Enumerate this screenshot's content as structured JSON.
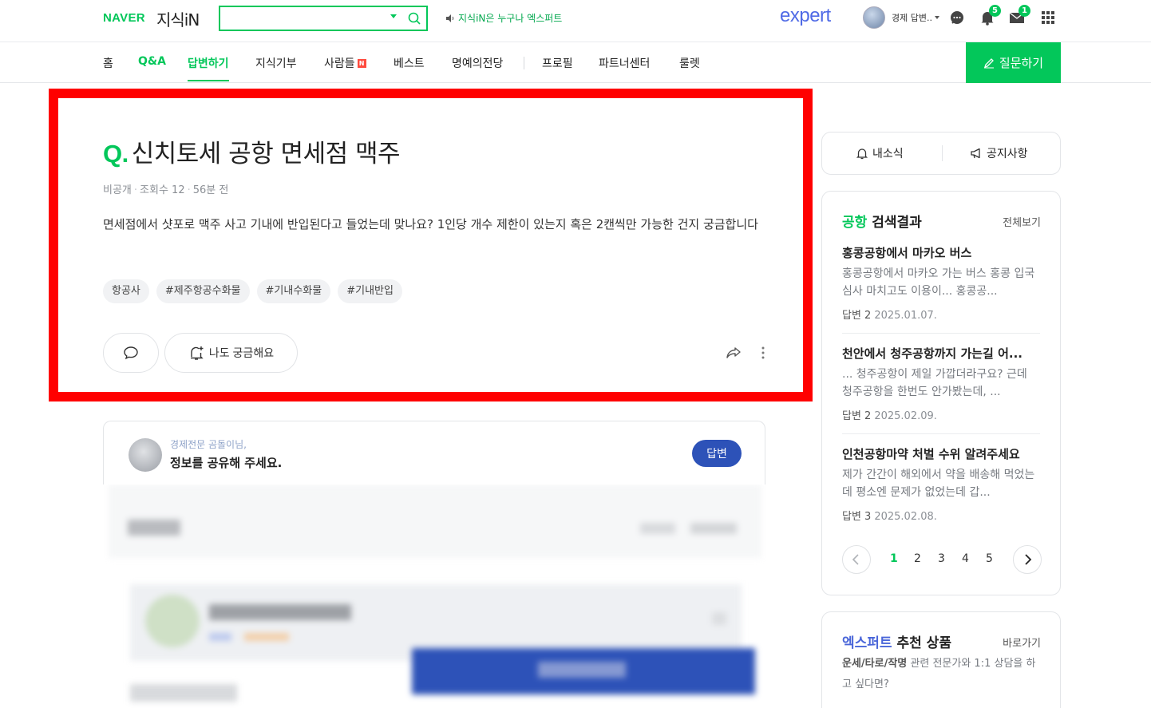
{
  "header": {
    "logo_naver": "NAVER",
    "logo_kin": "지식iN",
    "search_value": "",
    "notice": "지식iN은 누구나 엑스퍼트",
    "expert_logo": "expert",
    "user_name": "경제 답변..",
    "notifications_count": "5",
    "mail_count": "1"
  },
  "nav": {
    "items": [
      "홈",
      "Q&A",
      "답변하기",
      "지식기부",
      "사람들",
      "베스트",
      "명예의전당",
      "프로필",
      "파트너센터",
      "룰렛"
    ],
    "new_badge": "N",
    "ask_button": "질문하기"
  },
  "question": {
    "q_mark": "Q.",
    "title": "신치토세 공항 면세점 맥주",
    "meta": {
      "visibility": "비공개",
      "views": "조회수 12",
      "time": "56분 전"
    },
    "body": "면세점에서 샷포로 맥주 사고 기내에 반입된다고 들었는데 맞나요? 1인당 개수 제한이 있는지 혹은 2캔씩만 가능한 건지 궁금합니다",
    "tags": [
      "항공사",
      "#제주항공수화물",
      "#기내수화물",
      "#기내반입"
    ],
    "curious_button": "나도 궁금해요"
  },
  "answer_prompt": {
    "sub": "경제전문 곰돌이님,",
    "main": "정보를 공유해 주세요.",
    "button": "답변"
  },
  "sidebar": {
    "tabs": [
      "내소식",
      "공지사항"
    ],
    "results": {
      "keyword": "공항",
      "heading": "검색결과",
      "view_all": "전체보기",
      "items": [
        {
          "title": "홍콩공항에서 마카오 버스",
          "snippet": "홍콩공항에서 마카오 가는 버스 홍콩 입국심사 마치고도 이용이... 홍콩공...",
          "answers": "답변 2",
          "date": "2025.01.07."
        },
        {
          "title": "천안에서 청주공항까지 가는길 어...",
          "snippet": "... 청주공항이 제일 가깝더라구요? 근데 청주공항을 한번도 안가봤는데, ...",
          "answers": "답변 2",
          "date": "2025.02.09."
        },
        {
          "title": "인천공항마약 처벌 수위 알려주세요",
          "snippet": "제가 간간이 해외에서 약을 배송해 먹었는데 평소엔 문제가 없었는데 갑...",
          "answers": "답변 3",
          "date": "2025.02.08."
        }
      ],
      "pages": [
        "1",
        "2",
        "3",
        "4",
        "5"
      ],
      "current_page": "1"
    },
    "expert": {
      "heading_blue": "엑스퍼트",
      "heading_rest": "추천 상품",
      "go": "바로가기",
      "desc_bold": "운세/타로/작명",
      "desc_rest": "관련 전문가와 1:1 상담을 하고 싶다면?"
    }
  },
  "colors": {
    "brand_green": "#03c75a",
    "highlight_red": "#ff0000",
    "answer_blue": "#2d52b8",
    "expert_blue": "#4f6ae6"
  }
}
